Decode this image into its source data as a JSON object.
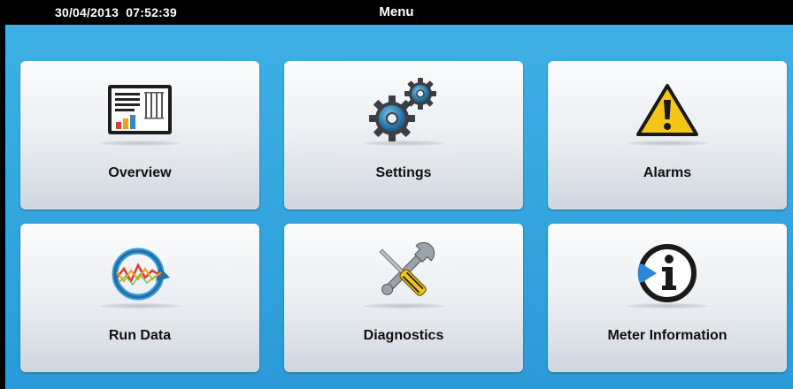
{
  "status_bar": {
    "date": "30/04/2013",
    "time": "07:52:39",
    "title": "Menu"
  },
  "menu": {
    "tiles": [
      {
        "label": "Overview",
        "icon": "overview-panel-icon"
      },
      {
        "label": "Settings",
        "icon": "gears-icon"
      },
      {
        "label": "Alarms",
        "icon": "warning-triangle-icon"
      },
      {
        "label": "Run Data",
        "icon": "trend-cycle-icon"
      },
      {
        "label": "Diagnostics",
        "icon": "wrench-screwdriver-icon"
      },
      {
        "label": "Meter Information",
        "icon": "information-icon"
      }
    ]
  },
  "colors": {
    "background_top": "#3fb0e6",
    "background_bottom": "#2b9ad8",
    "alarm_yellow": "#f5c518",
    "gear_blue": "#2f7fb0"
  }
}
